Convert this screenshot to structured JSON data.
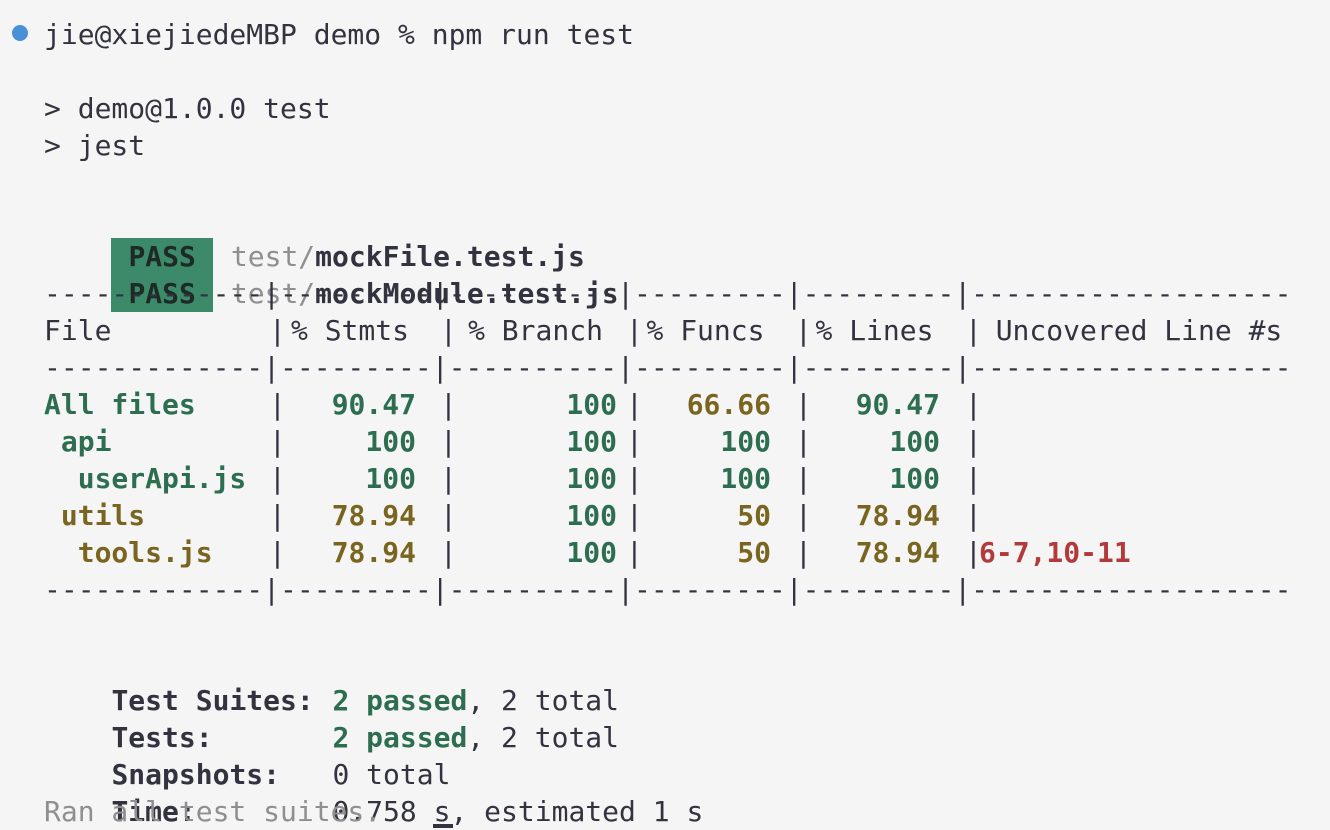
{
  "terminal": {
    "prompt": "jie@xiejiedeMBP demo % npm run test",
    "script_lines": [
      "> demo@1.0.0 test",
      "> jest"
    ],
    "test_results": [
      {
        "status": "PASS",
        "dir": "test/",
        "file": "mockFile.test.js"
      },
      {
        "status": "PASS",
        "dir": "test/",
        "file": "mockModule.test.js"
      }
    ],
    "coverage": {
      "separator": "-------------|---------|----------|---------|---------|-------------------",
      "headers": [
        "File",
        "% Stmts",
        "% Branch",
        "% Funcs",
        "% Lines",
        "Uncovered Line #s"
      ],
      "rows": [
        {
          "file": "All files",
          "stmts": "90.47",
          "branch": "100",
          "funcs": "66.66",
          "lines": "90.47",
          "uncovered": ""
        },
        {
          "file": " api",
          "stmts": "100",
          "branch": "100",
          "funcs": "100",
          "lines": "100",
          "uncovered": ""
        },
        {
          "file": "  userApi.js",
          "stmts": "100",
          "branch": "100",
          "funcs": "100",
          "lines": "100",
          "uncovered": ""
        },
        {
          "file": " utils",
          "stmts": "78.94",
          "branch": "100",
          "funcs": "50",
          "lines": "78.94",
          "uncovered": ""
        },
        {
          "file": "  tools.js",
          "stmts": "78.94",
          "branch": "100",
          "funcs": "50",
          "lines": "78.94",
          "uncovered": "6-7,10-11"
        }
      ]
    },
    "summary": {
      "suites_label": "Test Suites:",
      "suites_passed": "2 passed",
      "suites_total": ", 2 total",
      "tests_label": "Tests:",
      "tests_passed": "2 passed",
      "tests_total": ", 2 total",
      "snapshots_label": "Snapshots:",
      "snapshots_value": "0 total",
      "time_label": "Time:",
      "time_value": "0.758 s, estimated 1 s",
      "ran_all": "Ran all test suites."
    },
    "colors": {
      "background": "#f5f5f5",
      "pass_badge": "#3c8a6a",
      "covered": "#2e6e50",
      "partial": "#7a6520",
      "uncovered": "#b33a3a",
      "prompt_dot": "#4a90d9"
    }
  }
}
